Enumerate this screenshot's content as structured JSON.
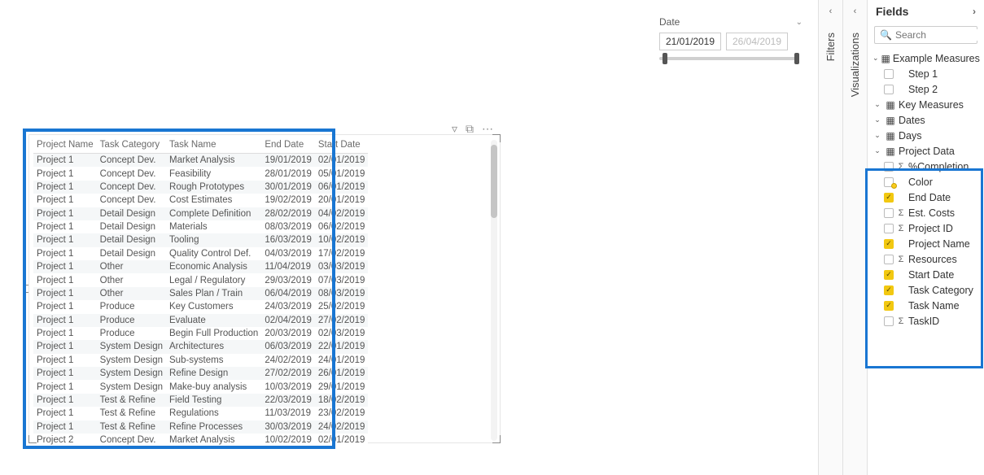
{
  "slicer": {
    "label": "Date",
    "start": "21/01/2019",
    "end": "26/04/2019"
  },
  "visual_header": {
    "filter": "filter",
    "focus": "focus",
    "more": "more"
  },
  "table": {
    "columns": [
      "Project Name",
      "Task Category",
      "Task Name",
      "End Date",
      "Start Date"
    ],
    "rows": [
      [
        "Project 1",
        "Concept Dev.",
        "Market Analysis",
        "19/01/2019",
        "02/01/2019"
      ],
      [
        "Project 1",
        "Concept Dev.",
        "Feasibility",
        "28/01/2019",
        "05/01/2019"
      ],
      [
        "Project 1",
        "Concept Dev.",
        "Rough Prototypes",
        "30/01/2019",
        "06/01/2019"
      ],
      [
        "Project 1",
        "Concept Dev.",
        "Cost Estimates",
        "19/02/2019",
        "20/01/2019"
      ],
      [
        "Project 1",
        "Detail Design",
        "Complete Definition",
        "28/02/2019",
        "04/02/2019"
      ],
      [
        "Project 1",
        "Detail Design",
        "Materials",
        "08/03/2019",
        "06/02/2019"
      ],
      [
        "Project 1",
        "Detail Design",
        "Tooling",
        "16/03/2019",
        "10/02/2019"
      ],
      [
        "Project 1",
        "Detail Design",
        "Quality Control Def.",
        "04/03/2019",
        "17/02/2019"
      ],
      [
        "Project 1",
        "Other",
        "Economic Analysis",
        "11/04/2019",
        "03/03/2019"
      ],
      [
        "Project 1",
        "Other",
        "Legal / Regulatory",
        "29/03/2019",
        "07/03/2019"
      ],
      [
        "Project 1",
        "Other",
        "Sales Plan / Train",
        "06/04/2019",
        "08/03/2019"
      ],
      [
        "Project 1",
        "Produce",
        "Key Customers",
        "24/03/2019",
        "25/02/2019"
      ],
      [
        "Project 1",
        "Produce",
        "Evaluate",
        "02/04/2019",
        "27/02/2019"
      ],
      [
        "Project 1",
        "Produce",
        "Begin Full Production",
        "20/03/2019",
        "02/03/2019"
      ],
      [
        "Project 1",
        "System Design",
        "Architectures",
        "06/03/2019",
        "22/01/2019"
      ],
      [
        "Project 1",
        "System Design",
        "Sub-systems",
        "24/02/2019",
        "24/01/2019"
      ],
      [
        "Project 1",
        "System Design",
        "Refine Design",
        "27/02/2019",
        "26/01/2019"
      ],
      [
        "Project 1",
        "System Design",
        "Make-buy analysis",
        "10/03/2019",
        "29/01/2019"
      ],
      [
        "Project 1",
        "Test & Refine",
        "Field Testing",
        "22/03/2019",
        "18/02/2019"
      ],
      [
        "Project 1",
        "Test & Refine",
        "Regulations",
        "11/03/2019",
        "23/02/2019"
      ],
      [
        "Project 1",
        "Test & Refine",
        "Refine Processes",
        "30/03/2019",
        "24/02/2019"
      ],
      [
        "Project 2",
        "Concept Dev.",
        "Market Analysis",
        "10/02/2019",
        "02/01/2019"
      ]
    ]
  },
  "panes": {
    "filters": "Filters",
    "visualizations": "Visualizations",
    "fields_title": "Fields",
    "search_placeholder": "Search"
  },
  "field_tables": [
    {
      "name": "Example Measures",
      "icon": "table",
      "expanded": true,
      "children": [
        {
          "name": "Step 1",
          "checked": false,
          "sigma": false
        },
        {
          "name": "Step 2",
          "checked": false,
          "sigma": false
        }
      ]
    },
    {
      "name": "Key Measures",
      "icon": "table",
      "expanded": false
    },
    {
      "name": "Dates",
      "icon": "table-grid",
      "expanded": false
    },
    {
      "name": "Days",
      "icon": "table-grid",
      "expanded": false
    },
    {
      "name": "Project Data",
      "icon": "table-grid",
      "expanded": true,
      "dot": true,
      "children": [
        {
          "name": "%Completion",
          "checked": false,
          "sigma": true
        },
        {
          "name": "Color",
          "checked": false,
          "sigma": false
        },
        {
          "name": "End Date",
          "checked": true,
          "sigma": false
        },
        {
          "name": "Est. Costs",
          "checked": false,
          "sigma": true
        },
        {
          "name": "Project ID",
          "checked": false,
          "sigma": true
        },
        {
          "name": "Project Name",
          "checked": true,
          "sigma": false
        },
        {
          "name": "Resources",
          "checked": false,
          "sigma": true
        },
        {
          "name": "Start Date",
          "checked": true,
          "sigma": false
        },
        {
          "name": "Task Category",
          "checked": true,
          "sigma": false
        },
        {
          "name": "Task Name",
          "checked": true,
          "sigma": false
        },
        {
          "name": "TaskID",
          "checked": false,
          "sigma": true
        }
      ]
    }
  ]
}
